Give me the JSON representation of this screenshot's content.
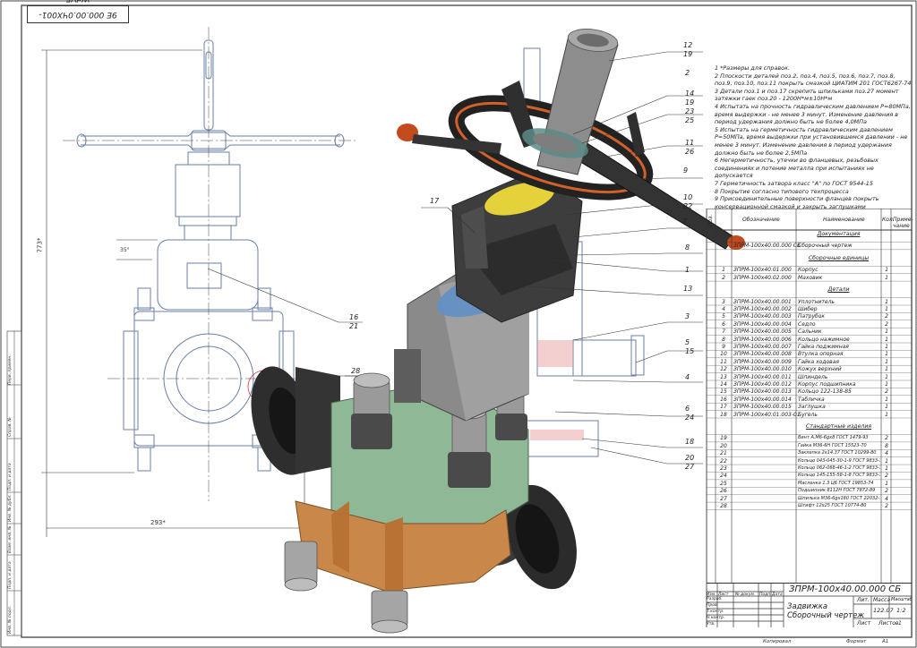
{
  "stamp": "9Е 000.00.0ЧX001-WdVE",
  "dimensions": {
    "height": "773*",
    "width": "293*",
    "angle": "35°"
  },
  "notes": [
    "1 *Размеры для справок.",
    "2 Плоскости деталей поз.2, поз.4, поз.5, поз.6, поз.7, поз.8, поз.9, поз.10, поз.11 покрыть смазкой ЦИАТИМ 201 ГОСТ6267-74",
    "3 Детали поз.1 и поз.17 скрепить шпильками поз.27 момент затяжки гаек поз.20 - 1200Н*м±10Н*м",
    "4 Испытать на прочность гидравлическим давлением P=80МПа, время выдержки - не менее 3 минут. Изменение давления в период удержания должно быть не более 4,0МПа",
    "5 Испытать на герметичность гидравлическим давлением P=50МПа, время выдержки при установившемся давлении - не менее 3 минут. Изменение давления в период удержания должно быть не более 2,5МПа",
    "6 Негерметичность, утечки во фланцевых, резьбовых соединениях и потение металла при испытаниях не допускается",
    "7 Герметичность затвора класс \"А\" по ГОСТ 9544-15",
    "8 Покрытие согласно типового техпроцесса",
    "9 Присоединительные поверхности фланцев покрыть консервационной смазкой и закрыть заглушками"
  ],
  "callouts": [
    {
      "label": "12",
      "sub": "19"
    },
    {
      "label": "2",
      "sub": ""
    },
    {
      "label": "14",
      "sub": "19"
    },
    {
      "label": "23",
      "sub": "25"
    },
    {
      "label": "11",
      "sub": "26"
    },
    {
      "label": "9",
      "sub": ""
    },
    {
      "label": "10",
      "sub": "22"
    },
    {
      "label": "7",
      "sub": ""
    },
    {
      "label": "8",
      "sub": ""
    },
    {
      "label": "1",
      "sub": ""
    },
    {
      "label": "13",
      "sub": ""
    },
    {
      "label": "3",
      "sub": ""
    },
    {
      "label": "5",
      "sub": "15"
    },
    {
      "label": "4",
      "sub": ""
    },
    {
      "label": "6",
      "sub": "24"
    },
    {
      "label": "18",
      "sub": ""
    },
    {
      "label": "20",
      "sub": "27"
    },
    {
      "label": "17",
      "sub": ""
    },
    {
      "label": "16",
      "sub": "21"
    },
    {
      "label": "28",
      "sub": ""
    }
  ],
  "bom": {
    "headers": [
      "Поз.",
      "Обозначение",
      "Наименование",
      "Кол.",
      "Приме-чание"
    ],
    "sections": [
      {
        "title": "Документация",
        "rows": [
          {
            "pos": "",
            "code": "ЗПРМ-100х40.00.000 СБ",
            "name": "Сборочный чертеж",
            "qty": ""
          }
        ]
      },
      {
        "title": "Сборочные единицы",
        "rows": [
          {
            "pos": "1",
            "code": "ЗПРМ-100х40.01.000",
            "name": "Корпус",
            "qty": "1"
          },
          {
            "pos": "2",
            "code": "ЗПРМ-100х40.02.000",
            "name": "Маховик",
            "qty": "1"
          }
        ]
      },
      {
        "title": "Детали",
        "rows": [
          {
            "pos": "3",
            "code": "ЗПРМ-100х40.00.001",
            "name": "Уплотнитель",
            "qty": "1"
          },
          {
            "pos": "4",
            "code": "ЗПРМ-100х40.00.002",
            "name": "Шибер",
            "qty": "1"
          },
          {
            "pos": "5",
            "code": "ЗПРМ-100х40.00.003",
            "name": "Патрубок",
            "qty": "2"
          },
          {
            "pos": "6",
            "code": "ЗПРМ-100х40.00.004",
            "name": "Седло",
            "qty": "2"
          },
          {
            "pos": "7",
            "code": "ЗПРМ-100х40.00.005",
            "name": "Сальник",
            "qty": "1"
          },
          {
            "pos": "8",
            "code": "ЗПРМ-100х40.00.006",
            "name": "Кольцо нажимное",
            "qty": "1"
          },
          {
            "pos": "9",
            "code": "ЗПРМ-100х40.00.007",
            "name": "Гайка поджимная",
            "qty": "1"
          },
          {
            "pos": "10",
            "code": "ЗПРМ-100х40.00.008",
            "name": "Втулка опорная",
            "qty": "1"
          },
          {
            "pos": "11",
            "code": "ЗПРМ-100х40.00.009",
            "name": "Гайка ходовая",
            "qty": "1"
          },
          {
            "pos": "12",
            "code": "ЗПРМ-100х40.00.010",
            "name": "Кожух верхний",
            "qty": "1"
          },
          {
            "pos": "13",
            "code": "ЗПРМ-100х40.00.011",
            "name": "Шпиндель",
            "qty": "1"
          },
          {
            "pos": "14",
            "code": "ЗПРМ-100х40.00.012",
            "name": "Корпус подшипника",
            "qty": "1"
          },
          {
            "pos": "15",
            "code": "ЗПРМ-100х40.00.013",
            "name": "Кольцо 122-138-85",
            "qty": "2"
          },
          {
            "pos": "16",
            "code": "ЗПРМ-100х40.00.014",
            "name": "Табличка",
            "qty": "1"
          },
          {
            "pos": "17",
            "code": "ЗПРМ-100х40.00.015",
            "name": "Заглушка",
            "qty": "1"
          },
          {
            "pos": "18",
            "code": "ЗПРМ-100х40.01.003-01",
            "name": "Бугель",
            "qty": "1"
          }
        ]
      },
      {
        "title": "Стандартные изделия",
        "rows": [
          {
            "pos": "19",
            "code": "",
            "name": "Винт А.М6-6gх8 ГОСТ 1479-93",
            "qty": "2"
          },
          {
            "pos": "20",
            "code": "",
            "name": "Гайка М36-6Н ГОСТ 15523-70",
            "qty": "8"
          },
          {
            "pos": "21",
            "code": "",
            "name": "Заклепка 2х14.37 ГОСТ 10299-80",
            "qty": "4"
          },
          {
            "pos": "22",
            "code": "",
            "name": "Кольцо 043-045-30-1-9 ГОСТ 9833-73",
            "qty": "1"
          },
          {
            "pos": "23",
            "code": "",
            "name": "Кольцо 062-068-46-1-2 ГОСТ 9833-73",
            "qty": "1"
          },
          {
            "pos": "24",
            "code": "",
            "name": "Кольцо 145-155-58-1-8 ГОСТ 9833-73",
            "qty": "2"
          },
          {
            "pos": "25",
            "code": "",
            "name": "Масленка 1.3 Ц6 ГОСТ 19853-74",
            "qty": "1"
          },
          {
            "pos": "26",
            "code": "",
            "name": "Подшипник 8112Н ГОСТ 7872-89",
            "qty": "2"
          },
          {
            "pos": "27",
            "code": "",
            "name": "Шпилька М36-6gх180 ГОСТ 22032-76",
            "qty": "4"
          },
          {
            "pos": "28",
            "code": "",
            "name": "Штифт 12х25 ГОСТ 10774-80",
            "qty": "2"
          }
        ]
      }
    ]
  },
  "title_block": {
    "designation": "ЗПРМ-100х40.00.000 СБ",
    "name_line1": "Задвижка",
    "name_line2": "Сборочный чертеж",
    "col_labels": [
      "Изм.",
      "Лист",
      "№ докум.",
      "Подп.",
      "Дата"
    ],
    "role_labels": [
      "Разраб.",
      "Пров.",
      "Т.контр.",
      "Н.контр.",
      "Утв."
    ],
    "lit_label": "Лит.",
    "mass_label": "Масса",
    "scale_label": "Масштаб",
    "mass": "122.07",
    "scale": "1:2",
    "sheet_label": "Лист",
    "sheets_label": "Листов",
    "sheets": "1"
  },
  "bottom_labels": {
    "copied": "Копировал",
    "format": "Формат",
    "format_value": "А1"
  },
  "side_fields": [
    "Перв. примен.",
    "Справ. №",
    "Подп. и дата",
    "Инв. № дубл.",
    "Взам. инв. №",
    "Подп. и дата",
    "Инв. № подл."
  ],
  "colors": {
    "green": "#8fb896",
    "orange": "#c9874a",
    "dark": "#2e2e2e",
    "gray": "#8a8a8a",
    "handwheel_rim": "#d2602a",
    "blue": "#5f8fc4",
    "yellow": "#e5d23a",
    "line": "#3c3c3c"
  }
}
